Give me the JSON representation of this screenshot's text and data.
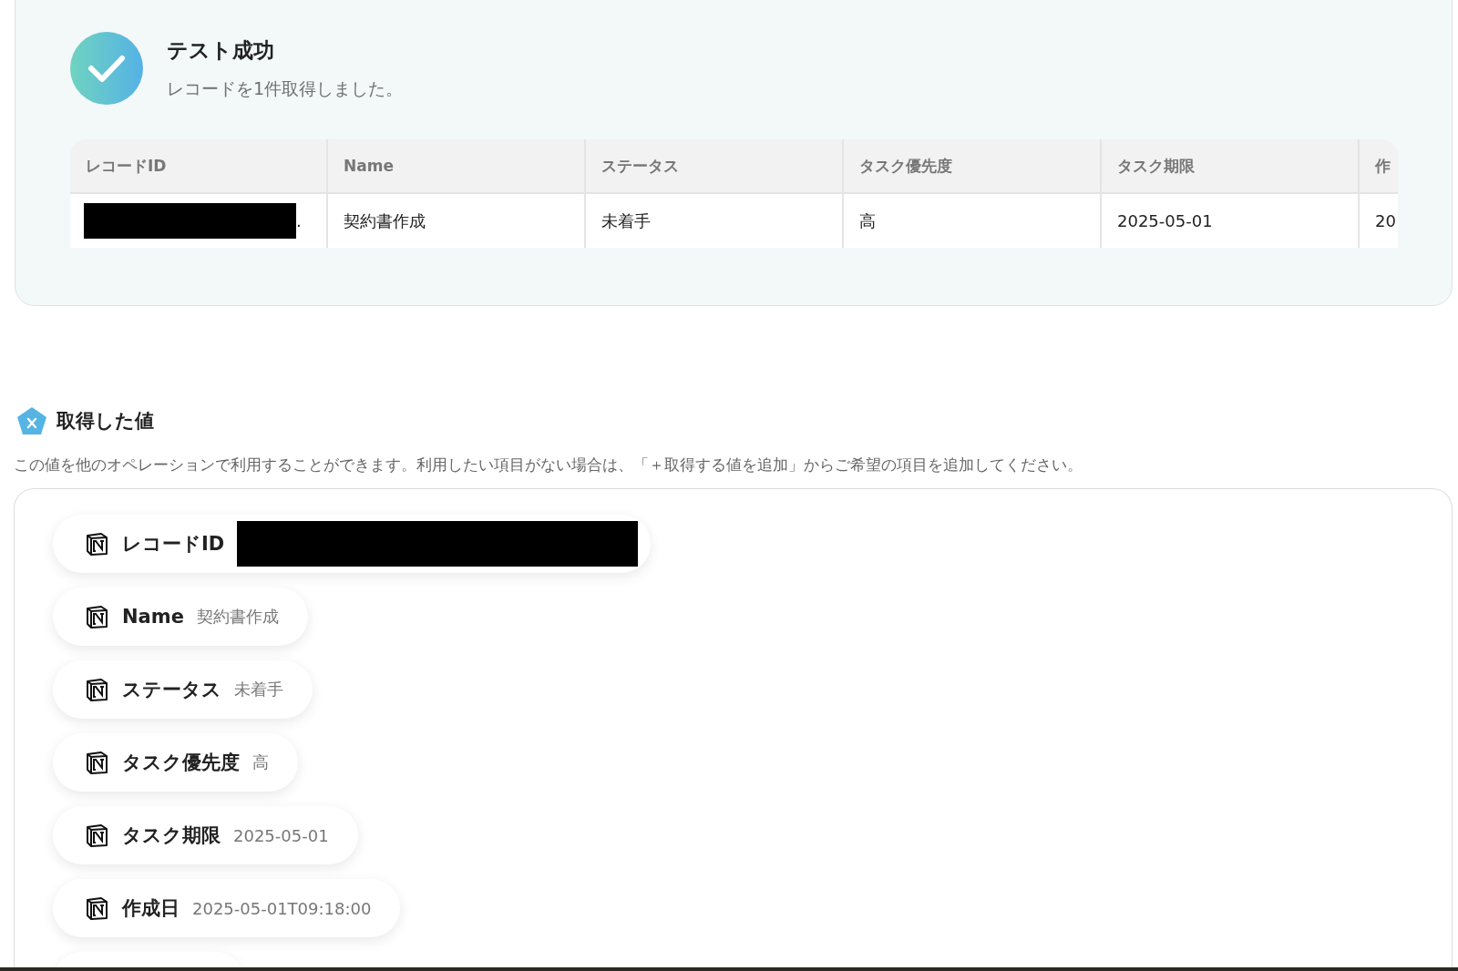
{
  "test_result": {
    "title": "テスト成功",
    "message": "レコードを1件取得しました。",
    "table": {
      "columns": [
        "レコードID",
        "Name",
        "ステータス",
        "タスク優先度",
        "タスク期限",
        "作"
      ],
      "rows": [
        {
          "cells": [
            {
              "kind": "redacted",
              "text": "."
            },
            {
              "kind": "text",
              "text": "契約書作成"
            },
            {
              "kind": "text",
              "text": "未着手"
            },
            {
              "kind": "text",
              "text": "高"
            },
            {
              "kind": "text",
              "text": "2025-05-01"
            },
            {
              "kind": "text",
              "text": "20"
            }
          ]
        }
      ]
    }
  },
  "values_section": {
    "title": "取得した値",
    "description": "この値を他のオペレーションで利用することができます。利用したい項目がない場合は、「＋取得する値を追加」からご希望の項目を追加してください。",
    "items": [
      {
        "label": "レコードID",
        "kind": "redacted"
      },
      {
        "label": "Name",
        "kind": "text",
        "value": "契約書作成"
      },
      {
        "label": "ステータス",
        "kind": "text",
        "value": "未着手"
      },
      {
        "label": "タスク優先度",
        "kind": "text",
        "value": "高"
      },
      {
        "label": "タスク期限",
        "kind": "text",
        "value": "2025-05-01"
      },
      {
        "label": "作成日",
        "kind": "text",
        "value": "2025-05-01T09:18:00"
      }
    ]
  }
}
